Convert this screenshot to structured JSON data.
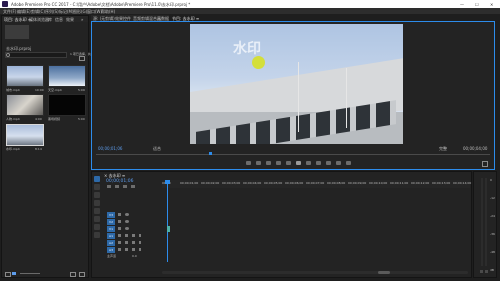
{
  "window": {
    "title": "Adobe Premiere Pro CC 2017 - C:\\用户\\Adobe\\文档\\Adobe\\Premiere Pro\\11.0\\去水印.prproj *",
    "minimize": "—",
    "maximize": "☐",
    "close": "✕"
  },
  "menu": [
    "文件(F)",
    "编辑(E)",
    "剪辑(C)",
    "序列(S)",
    "标记(M)",
    "图形(G)",
    "窗口(W)",
    "帮助(H)"
  ],
  "project_panel": {
    "tabs": [
      "项目: 去水印 ≡",
      "媒体浏览器",
      "库",
      "信息",
      "效果",
      "»"
    ],
    "project_name": "去水印.prproj",
    "search_placeholder": "",
    "item_count": "1 项已选择，共 5 项",
    "items": [
      {
        "name": "城市.mp4",
        "duration": "10:00"
      },
      {
        "name": "天空.mp4",
        "duration": "5:09"
      },
      {
        "name": "人物.mp4",
        "duration": "4:00"
      },
      {
        "name": "黑场视频",
        "duration": "5:00"
      },
      {
        "name": "水印.mp4",
        "duration": "8:14"
      }
    ]
  },
  "source_tabs": [
    "源: (无剪辑)",
    "效果控件",
    "音频剪辑混合器",
    "元数据"
  ],
  "program": {
    "tab": "节目: 去水印 ≡",
    "watermark_text": "水印",
    "timecode": "00;00;01;06",
    "fit": "适合",
    "quality": "完整",
    "duration": "00;00;04;00"
  },
  "timeline": {
    "tab": "× 去水印 ≡",
    "timecode": "00;00;01;06",
    "ruler": [
      "00;00",
      "00;00;01;00",
      "00;00;02;00",
      "00;00;03;00",
      "00;00;04;00",
      "00;00;05;00",
      "00;00;06;00",
      "00;00;07;00",
      "00;00;08;00",
      "00;00;09;00",
      "00;00;10;00",
      "00;00;11;00",
      "00;00;12;00",
      "00;00;13;00",
      "00;00;14;00"
    ],
    "tracks": [
      "V3",
      "V2",
      "V1",
      "A1",
      "A2",
      "A3"
    ],
    "master": "主声道",
    "master_value": "0.0"
  },
  "meters": [
    "0",
    "-12",
    "-24",
    "-36",
    "-48",
    "dB"
  ],
  "colors": {
    "accent": "#2d8ceb",
    "timecode": "#5d9cec",
    "clip": "#4db0a8",
    "track_label": "#2d69a8"
  }
}
